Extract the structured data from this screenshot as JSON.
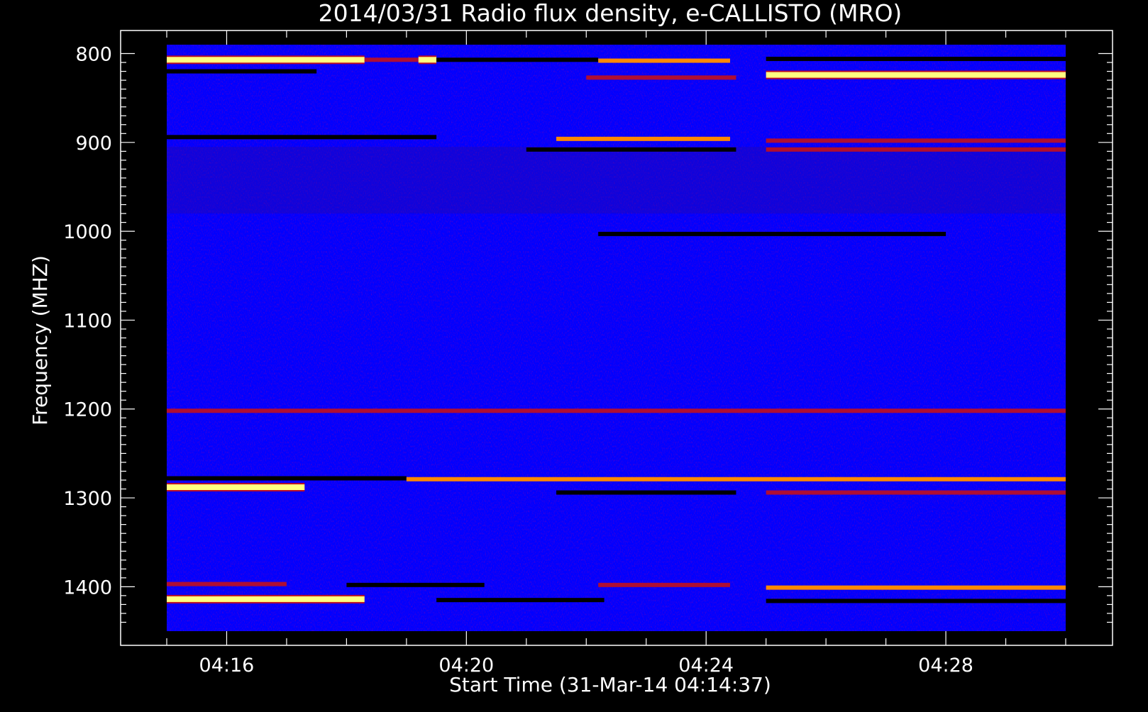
{
  "chart_data": {
    "type": "heatmap",
    "title": "2014/03/31  Radio flux density, e-CALLISTO (MRO)",
    "xlabel": "Start Time (31-Mar-14 04:14:37)",
    "ylabel": "Frequency (MHZ)",
    "x_ticks": [
      "04:16",
      "04:20",
      "04:24",
      "04:28"
    ],
    "x_tick_values_min": [
      16,
      20,
      24,
      28
    ],
    "x_range_min": [
      15.0,
      30.0
    ],
    "y_ticks": [
      "800",
      "900",
      "1000",
      "1100",
      "1200",
      "1300",
      "1400"
    ],
    "y_tick_values": [
      800,
      900,
      1000,
      1100,
      1200,
      1300,
      1400
    ],
    "y_range": [
      790,
      1450
    ],
    "y_inverted": true,
    "colors": {
      "background": "#0000ff",
      "low": "#000000",
      "mid": "#cc1010",
      "high": "#ff8800",
      "peak": "#ffff80",
      "frame": "#ffffff",
      "page": "#000000"
    },
    "bands": [
      {
        "freq": 807,
        "t0": 15.0,
        "t1": 18.3,
        "level": "peak"
      },
      {
        "freq": 807,
        "t0": 18.3,
        "t1": 19.2,
        "level": "mid"
      },
      {
        "freq": 807,
        "t0": 19.2,
        "t1": 19.5,
        "level": "peak"
      },
      {
        "freq": 807,
        "t0": 19.5,
        "t1": 22.2,
        "level": "low"
      },
      {
        "freq": 808,
        "t0": 22.2,
        "t1": 24.4,
        "level": "high"
      },
      {
        "freq": 806,
        "t0": 25.0,
        "t1": 30.0,
        "level": "low"
      },
      {
        "freq": 820,
        "t0": 15.0,
        "t1": 17.5,
        "level": "low"
      },
      {
        "freq": 824,
        "t0": 25.0,
        "t1": 30.0,
        "level": "peak"
      },
      {
        "freq": 827,
        "t0": 22.0,
        "t1": 24.5,
        "level": "mid"
      },
      {
        "freq": 894,
        "t0": 15.0,
        "t1": 19.5,
        "level": "low"
      },
      {
        "freq": 896,
        "t0": 21.5,
        "t1": 24.4,
        "level": "high"
      },
      {
        "freq": 898,
        "t0": 25.0,
        "t1": 30.0,
        "level": "mid"
      },
      {
        "freq": 908,
        "t0": 25.0,
        "t1": 30.0,
        "level": "mid"
      },
      {
        "freq": 908,
        "t0": 21.0,
        "t1": 24.5,
        "level": "low"
      },
      {
        "freq": 1003,
        "t0": 22.2,
        "t1": 28.0,
        "level": "low"
      },
      {
        "freq": 1202,
        "t0": 15.0,
        "t1": 30.0,
        "level": "mid"
      },
      {
        "freq": 1278,
        "t0": 15.0,
        "t1": 19.0,
        "level": "low"
      },
      {
        "freq": 1279,
        "t0": 19.0,
        "t1": 30.0,
        "level": "high"
      },
      {
        "freq": 1288,
        "t0": 15.0,
        "t1": 17.3,
        "level": "peak"
      },
      {
        "freq": 1294,
        "t0": 21.5,
        "t1": 24.5,
        "level": "low"
      },
      {
        "freq": 1294,
        "t0": 25.0,
        "t1": 30.0,
        "level": "mid"
      },
      {
        "freq": 1397,
        "t0": 15.0,
        "t1": 17.0,
        "level": "mid"
      },
      {
        "freq": 1398,
        "t0": 18.0,
        "t1": 20.3,
        "level": "low"
      },
      {
        "freq": 1398,
        "t0": 22.2,
        "t1": 24.4,
        "level": "mid"
      },
      {
        "freq": 1401,
        "t0": 25.0,
        "t1": 30.0,
        "level": "high"
      },
      {
        "freq": 1414,
        "t0": 15.0,
        "t1": 18.3,
        "level": "peak"
      },
      {
        "freq": 1415,
        "t0": 19.5,
        "t1": 22.3,
        "level": "low"
      },
      {
        "freq": 1416,
        "t0": 25.0,
        "t1": 30.0,
        "level": "low"
      }
    ]
  }
}
